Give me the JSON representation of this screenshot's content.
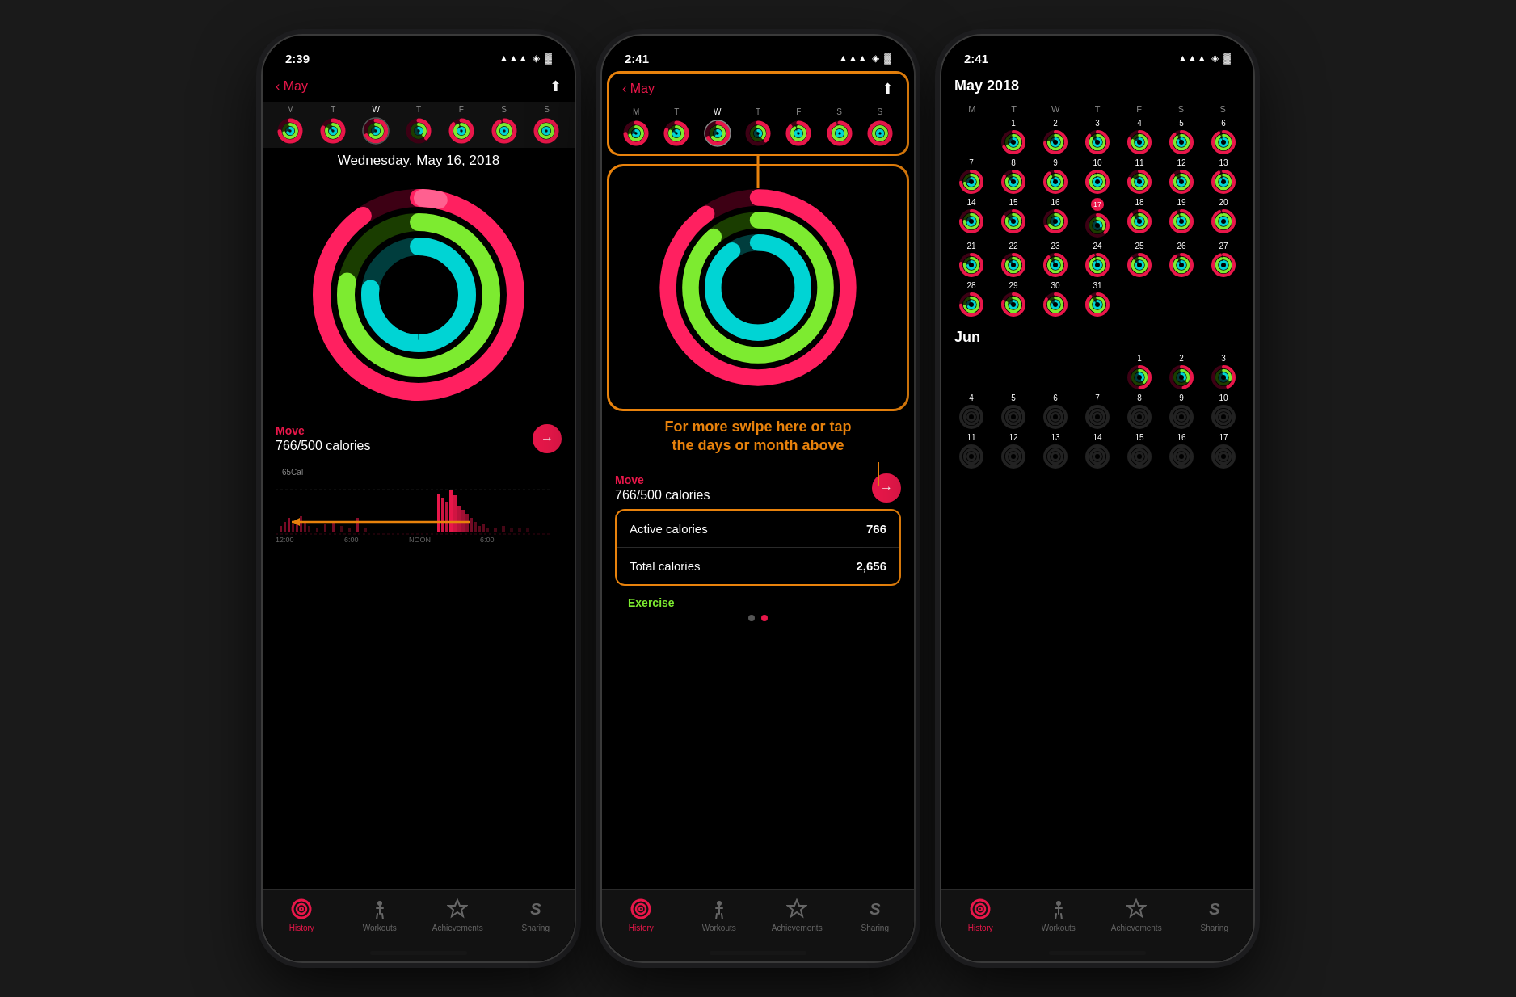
{
  "phones": [
    {
      "id": "phone1",
      "statusBar": {
        "time": "2:39",
        "showLocation": true
      },
      "nav": {
        "back": "May",
        "showShare": true
      },
      "weekDays": [
        "M",
        "T",
        "W",
        "T",
        "F",
        "S",
        "S"
      ],
      "currentDayIndex": 2,
      "date": "Wednesday, May 16, 2018",
      "move": {
        "label": "Move",
        "value": "766/500 calories"
      },
      "chartTimes": [
        "12:00",
        "6:00",
        "NOON",
        "6:00"
      ],
      "tabs": [
        {
          "label": "History",
          "active": true
        },
        {
          "label": "Workouts",
          "active": false
        },
        {
          "label": "Achievements",
          "active": false
        },
        {
          "label": "Sharing",
          "active": false
        }
      ]
    },
    {
      "id": "phone2",
      "statusBar": {
        "time": "2:41",
        "showLocation": true
      },
      "nav": {
        "back": "May",
        "showShare": true
      },
      "weekDays": [
        "M",
        "T",
        "W",
        "T",
        "F",
        "S",
        "S"
      ],
      "currentDayIndex": 2,
      "annotation": "For more swipe here or tap\nthe days or month above",
      "move": {
        "label": "Move",
        "value": "766/500 calories"
      },
      "details": [
        {
          "label": "Active calories",
          "value": "766"
        },
        {
          "label": "Total calories",
          "value": "2,656"
        }
      ],
      "exerciseLabel": "Exercise",
      "tabs": [
        {
          "label": "History",
          "active": true
        },
        {
          "label": "Workouts",
          "active": false
        },
        {
          "label": "Achievements",
          "active": false
        },
        {
          "label": "Sharing",
          "active": false
        }
      ]
    },
    {
      "id": "phone3",
      "statusBar": {
        "time": "2:41",
        "showLocation": true
      },
      "nav": {
        "back": null,
        "showShare": false
      },
      "calendarTitle": "May 2018",
      "weekDays": [
        "M",
        "T",
        "W",
        "T",
        "F",
        "S",
        "S"
      ],
      "mayDates": [
        [
          null,
          1,
          2,
          3,
          4,
          5,
          6
        ],
        [
          7,
          8,
          9,
          10,
          11,
          12,
          13
        ],
        [
          14,
          15,
          16,
          17,
          18,
          19,
          20
        ],
        [
          21,
          22,
          23,
          24,
          25,
          26,
          27
        ],
        [
          28,
          29,
          30,
          31,
          null,
          null,
          null
        ]
      ],
      "junTitle": "Jun",
      "junDates": [
        [
          null,
          null,
          null,
          null,
          1,
          2,
          3
        ],
        [
          4,
          5,
          6,
          7,
          8,
          9,
          10
        ],
        [
          11,
          12,
          13,
          14,
          15,
          16,
          17
        ]
      ],
      "todayDate": 17,
      "tabs": [
        {
          "label": "History",
          "active": true
        },
        {
          "label": "Workouts",
          "active": false
        },
        {
          "label": "Achievements",
          "active": false
        },
        {
          "label": "Sharing",
          "active": false
        }
      ]
    }
  ]
}
